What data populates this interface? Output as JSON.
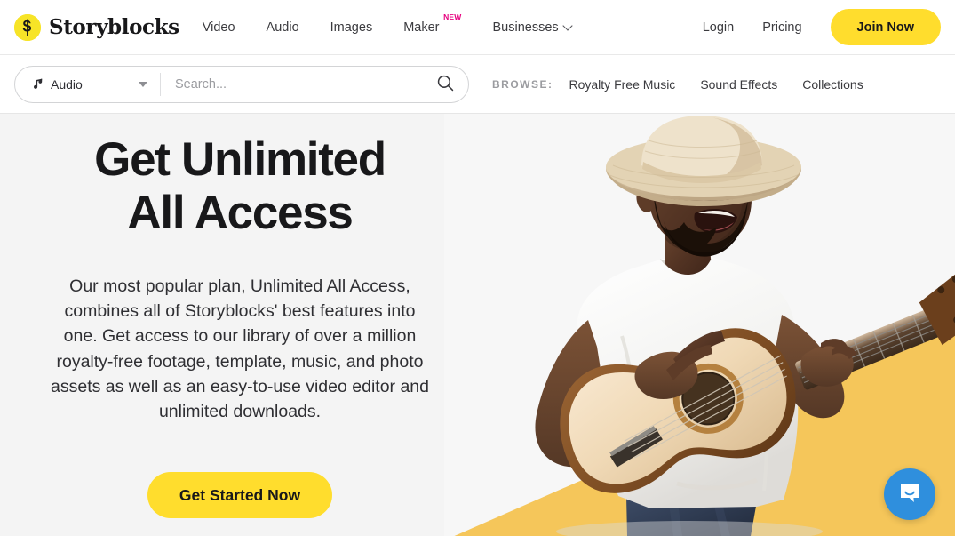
{
  "brand": {
    "name": "Storyblocks",
    "mark_icon": "storyblocks-s-logo",
    "mark_color": "#f7e427"
  },
  "nav": {
    "items": [
      {
        "label": "Video",
        "icon": null,
        "badge": null
      },
      {
        "label": "Audio",
        "icon": null,
        "badge": null
      },
      {
        "label": "Images",
        "icon": null,
        "badge": null
      },
      {
        "label": "Maker",
        "icon": null,
        "badge": "NEW"
      }
    ],
    "businesses": {
      "label": "Businesses",
      "icon": "chevron-down-icon"
    },
    "badge_color": "#e6007e",
    "login_label": "Login",
    "pricing_label": "Pricing",
    "join_label": "Join Now",
    "join_color": "#ffdd2d"
  },
  "search": {
    "category": "Audio",
    "category_icon": "music-note-icon",
    "dropdown_icon": "caret-down-icon",
    "placeholder": "Search...",
    "value": "",
    "submit_icon": "search-icon"
  },
  "browse": {
    "label": "BROWSE:",
    "links": [
      {
        "label": "Royalty Free Music"
      },
      {
        "label": "Sound Effects"
      },
      {
        "label": "Collections"
      }
    ]
  },
  "hero": {
    "title": "Get Unlimited All Access",
    "description": "Our most popular plan, Unlimited All Access, combines all of Storyblocks' best features into one. Get access to our library of over a million royalty-free footage, template, music, and photo assets as well as an easy-to-use video editor and unlimited downloads.",
    "cta_label": "Get Started Now",
    "background_color": "#f4f4f4",
    "accent_color": "#f5c65a",
    "image_alt": "Man in straw hat playing acoustic guitar"
  },
  "chat": {
    "icon": "chat-bubble-smile-icon",
    "color": "#2f8fdd"
  }
}
